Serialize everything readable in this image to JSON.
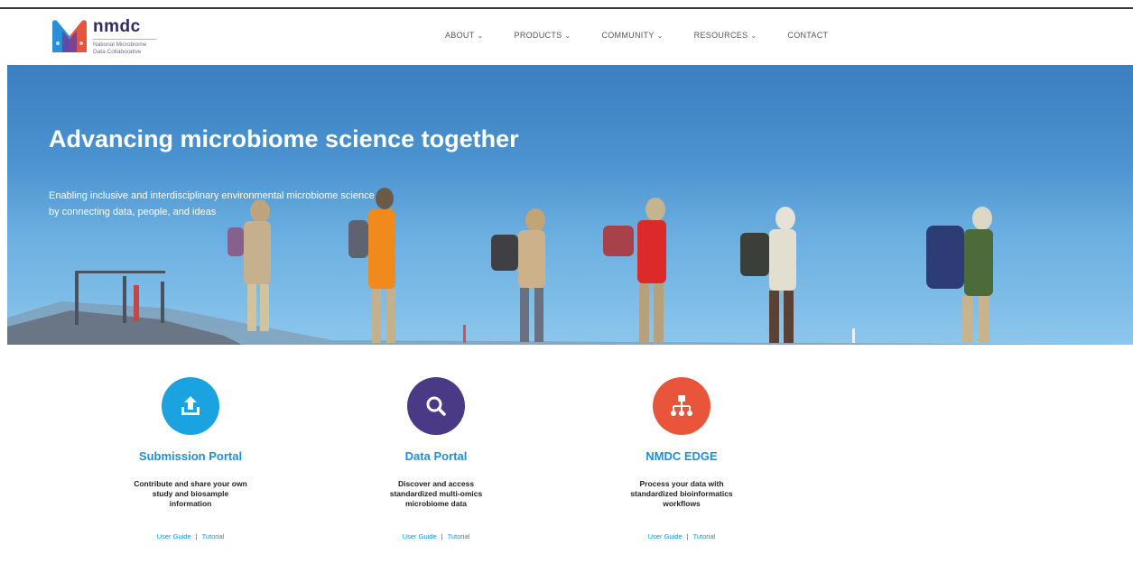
{
  "brand": {
    "name": "nmdc",
    "subtitle_line1": "National Microbiome",
    "subtitle_line2": "Data Collaborative"
  },
  "nav": {
    "items": [
      {
        "label": "ABOUT",
        "has_dropdown": true
      },
      {
        "label": "PRODUCTS",
        "has_dropdown": true
      },
      {
        "label": "COMMUNITY",
        "has_dropdown": true
      },
      {
        "label": "RESOURCES",
        "has_dropdown": true
      },
      {
        "label": "CONTACT",
        "has_dropdown": false
      }
    ],
    "dropdown_icon": "chevron-down-icon"
  },
  "hero": {
    "title": "Advancing microbiome science together",
    "subtitle_line1": "Enabling inclusive and interdisciplinary environmental microbiome science",
    "subtitle_line2": "by connecting data, people, and ideas"
  },
  "cards": [
    {
      "title": "Submission Portal",
      "desc_line1": "Contribute and share your own",
      "desc_line2": "study and biosample",
      "desc_line3": "information",
      "icon": "upload-icon",
      "color": "#1aa3e0",
      "link1": "User Guide",
      "sep": "|",
      "link2": "Tutorial"
    },
    {
      "title": "Data Portal",
      "desc_line1": "Discover and access",
      "desc_line2": "standardized multi-omics",
      "desc_line3": "microbiome data",
      "icon": "search-icon",
      "color": "#4a3a86",
      "link1": "User Guide",
      "sep": "|",
      "link2": "Tutorial"
    },
    {
      "title": "NMDC EDGE",
      "desc_line1": "Process your data with",
      "desc_line2": "standardized bioinformatics",
      "desc_line3": "workflows",
      "icon": "hierarchy-icon",
      "color": "#e8553a",
      "link1": "User Guide",
      "sep": "|",
      "link2": "Tutorial"
    }
  ],
  "colors": {
    "link": "#1f8fd6",
    "brand_dark": "#2f2a64"
  }
}
